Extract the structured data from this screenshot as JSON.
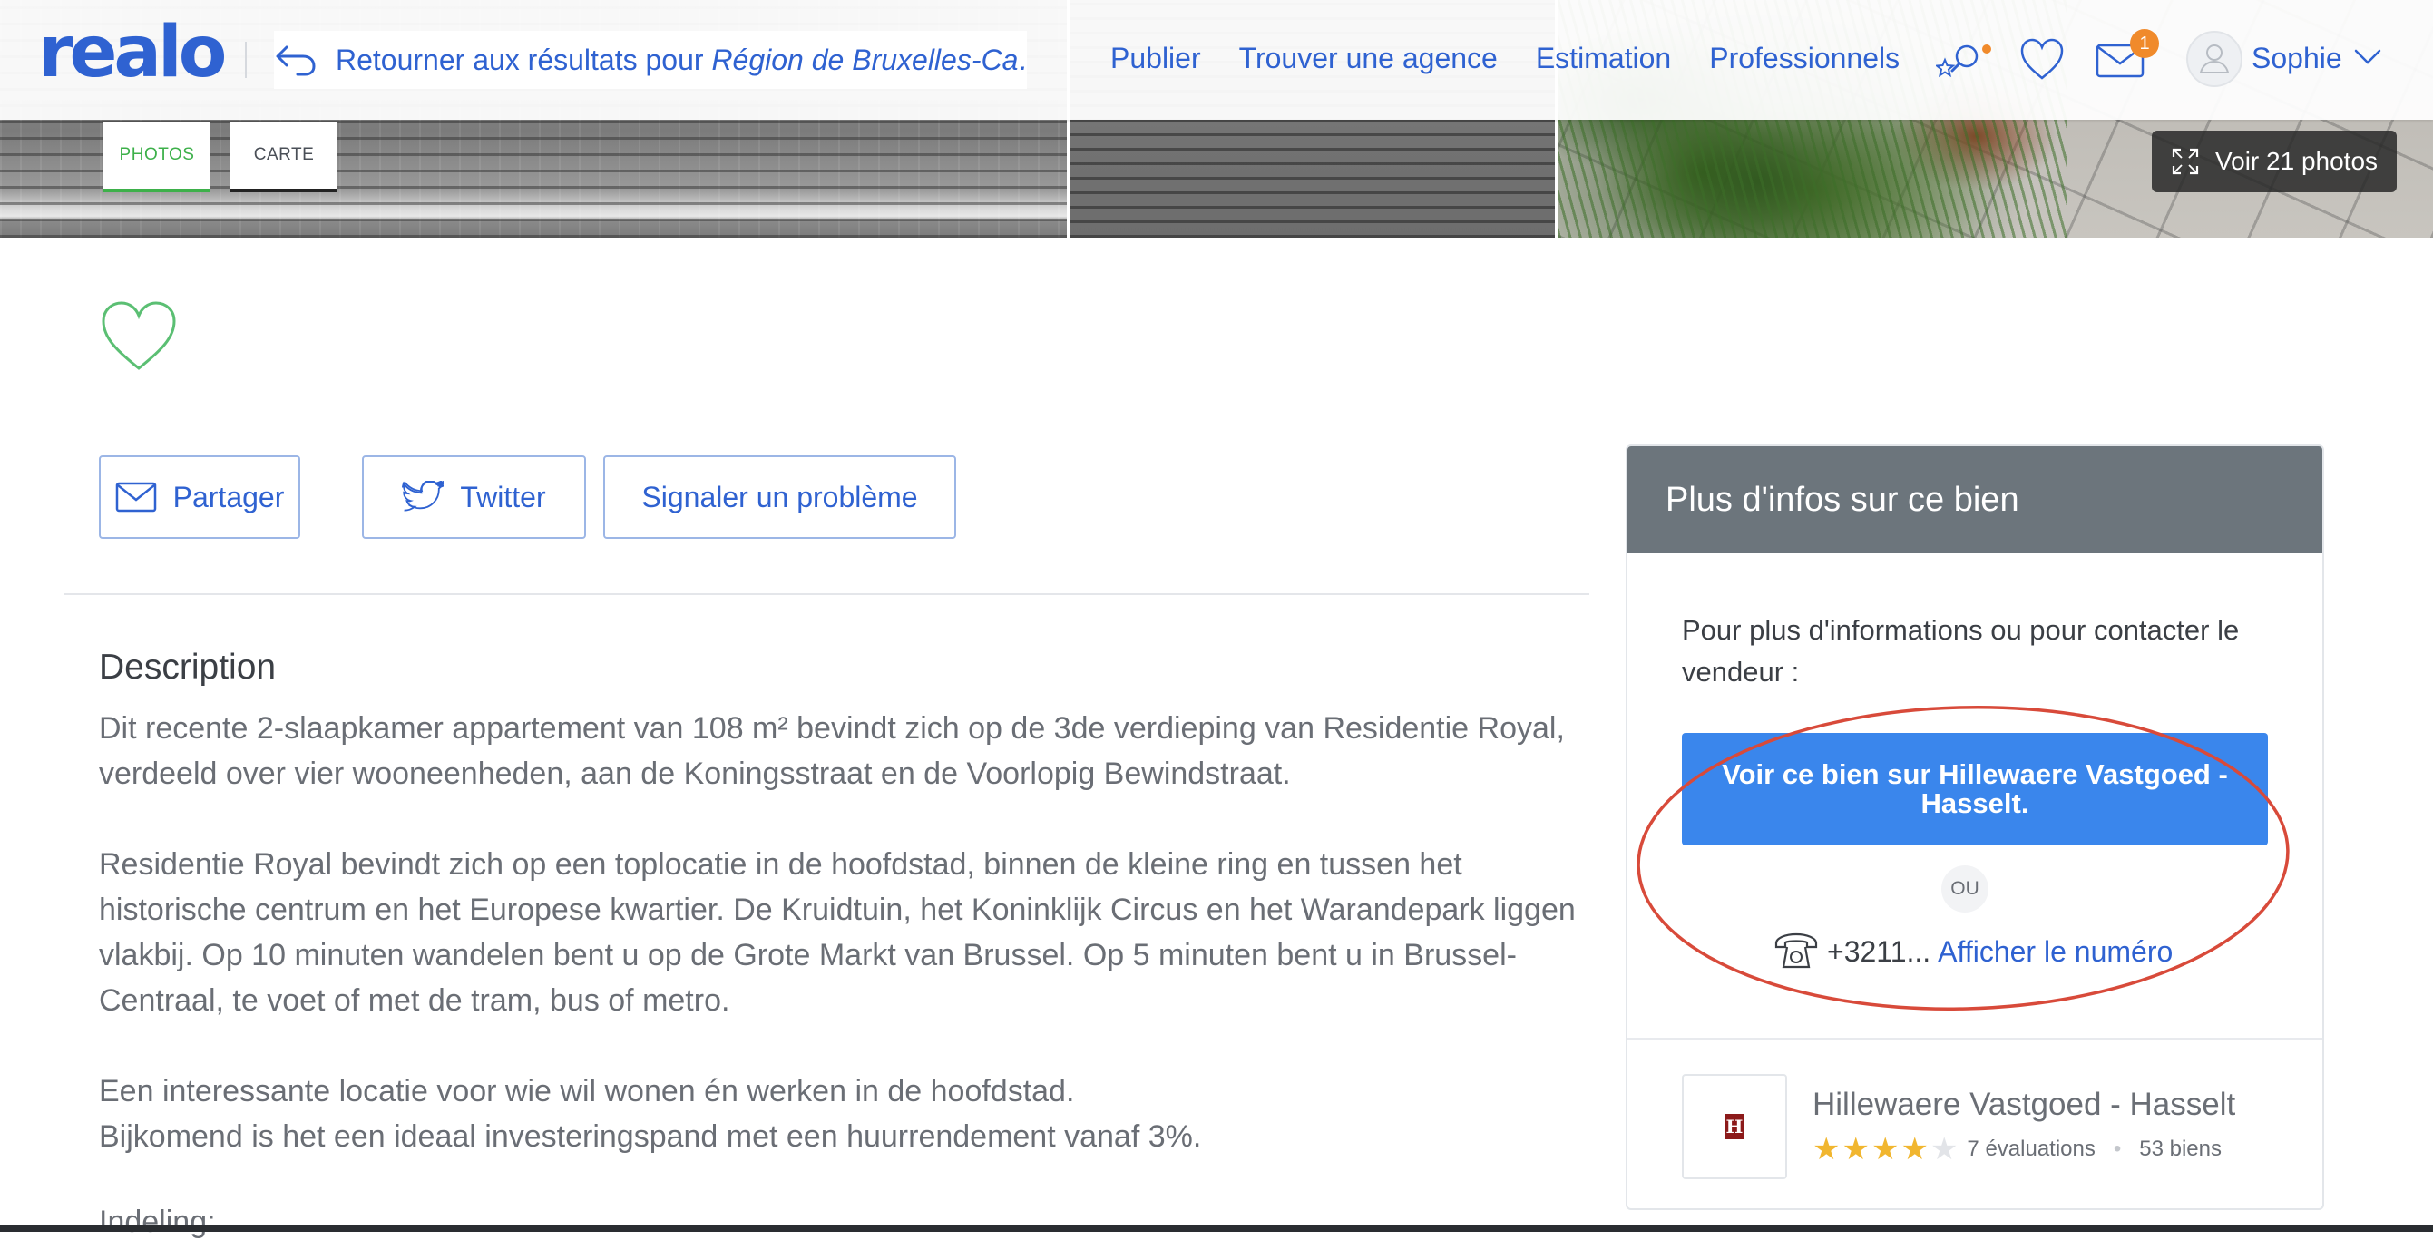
{
  "brand": {
    "logo_text": "realo",
    "accent": "#2f62d1",
    "green": "#3db04a"
  },
  "nav": {
    "back_text": "Retourner aux résultats pour ",
    "back_location": "Région de Bruxelles-Ca…",
    "links": [
      "Publier",
      "Trouver une agence",
      "Estimation",
      "Professionnels"
    ],
    "icons": [
      "search-star-icon",
      "heart-icon",
      "mail-icon",
      "avatar-icon",
      "chevron-down-icon"
    ],
    "mail_badge": "1",
    "user_name": "Sophie"
  },
  "media": {
    "tabs": [
      "PHOTOS",
      "CARTE"
    ],
    "active_tab": "PHOTOS",
    "photos_button": "Voir 21 photos"
  },
  "actions": {
    "share": "Partager",
    "twitter": "Twitter",
    "report": "Signaler un problème"
  },
  "description": {
    "title": "Description",
    "paragraphs": [
      "Dit recente 2-slaapkamer appartement van 108 m² bevindt zich op de 3de verdieping van Residentie Royal, verdeeld over vier wooneenheden, aan de Koningsstraat en de Voorlopig Bewindstraat.",
      "Residentie Royal bevindt zich op een toplocatie in de hoofdstad, binnen de kleine ring en tussen het historische centrum en het Europese kwartier. De Kruidtuin, het Koninklijk Circus en het Warandepark liggen vlakbij. Op 10 minuten wandelen bent u op de Grote Markt van Brussel. Op 5 minuten bent u in Brussel-Centraal, te voet of met de tram, bus of metro.",
      "Een interessante locatie voor wie wil wonen én werken in de hoofdstad.",
      "Bijkomend is het een ideaal investeringspand met een huurrendement vanaf 3%."
    ],
    "next_heading": "Indeling:"
  },
  "contact_card": {
    "title": "Plus d'infos sur ce bien",
    "info": "Pour plus d'informations ou pour contacter le vendeur :",
    "seller_button": "Voir ce bien sur Hillewaere Vastgoed - Hasselt.",
    "or_label": "OU",
    "phone_partial": "+3211...",
    "phone_link": "Afficher le numéro",
    "agency": {
      "name": "Hillewaere Vastgoed - Hasselt",
      "logo_letter": "H",
      "rating_stars": 4,
      "rating_max": 5,
      "reviews": "7 évaluations",
      "listings": "53 biens"
    }
  }
}
